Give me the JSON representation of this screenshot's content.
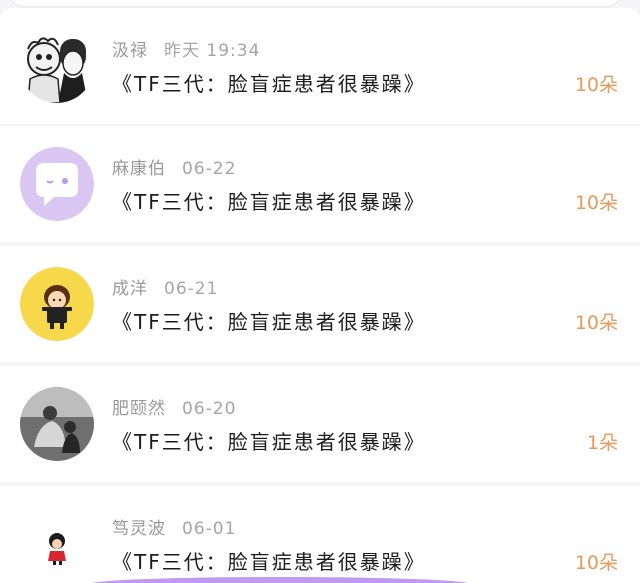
{
  "list": {
    "items": [
      {
        "name": "汲禄",
        "time": "昨天 19:34",
        "title": "《TF三代：脸盲症患者很暴躁》",
        "count": "10朵",
        "avatar": "couple-sketch-avatar"
      },
      {
        "name": "麻康伯",
        "time": "06-22",
        "title": "《TF三代：脸盲症患者很暴躁》",
        "count": "10朵",
        "avatar": "chat-bubble-avatar"
      },
      {
        "name": "成洋",
        "time": "06-21",
        "title": "《TF三代：脸盲症患者很暴躁》",
        "count": "10朵",
        "avatar": "cartoon-girl-yellow-avatar"
      },
      {
        "name": "肥颐然",
        "time": "06-20",
        "title": "《TF三代：脸盲症患者很暴躁》",
        "count": "1朵",
        "avatar": "photo-people-avatar"
      },
      {
        "name": "笃灵波",
        "time": "06-01",
        "title": "《TF三代：脸盲症患者很暴躁》",
        "count": "10朵",
        "avatar": "small-cartoon-figure-avatar"
      }
    ]
  },
  "colors": {
    "count": "#e49a5a",
    "name": "#9a9a9a",
    "title": "#1c1c1c",
    "accent_purple": "#b98ff0"
  }
}
